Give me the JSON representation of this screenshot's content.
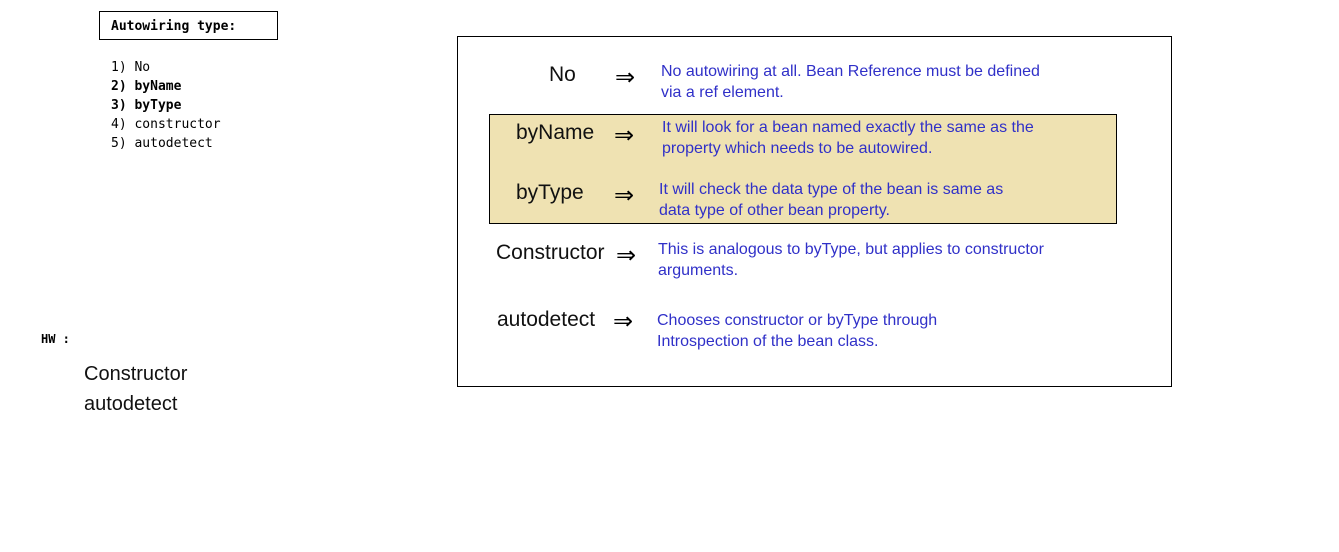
{
  "header": {
    "title": "Autowiring type:"
  },
  "types": [
    {
      "label": "1) No",
      "bold": false
    },
    {
      "label": "2) byName",
      "bold": true
    },
    {
      "label": "3) byType",
      "bold": true
    },
    {
      "label": "4) constructor",
      "bold": false
    },
    {
      "label": "5) autodetect",
      "bold": false
    }
  ],
  "homework": {
    "label": "HW :",
    "items": [
      "Constructor",
      "autodetect"
    ]
  },
  "diagram": {
    "arrow_glyph": "⇒",
    "highlight_color": "#efe2b2",
    "description_color": "#3030c8",
    "rows": [
      {
        "term": "No",
        "line1": "No autowiring at all. Bean Reference must be defined",
        "line2": "via a ref element."
      },
      {
        "term": "byName",
        "line1": "It will look for a bean named exactly the same as the",
        "line2": "property which needs to be autowired."
      },
      {
        "term": "byType",
        "line1": "It will check the data type of the bean is same as",
        "line2": "data type of other bean property."
      },
      {
        "term": "Constructor",
        "line1": "This is analogous to byType, but applies to constructor",
        "line2": "arguments."
      },
      {
        "term": "autodetect",
        "line1": "Chooses constructor or byType through",
        "line2": "Introspection of the bean class."
      }
    ]
  }
}
